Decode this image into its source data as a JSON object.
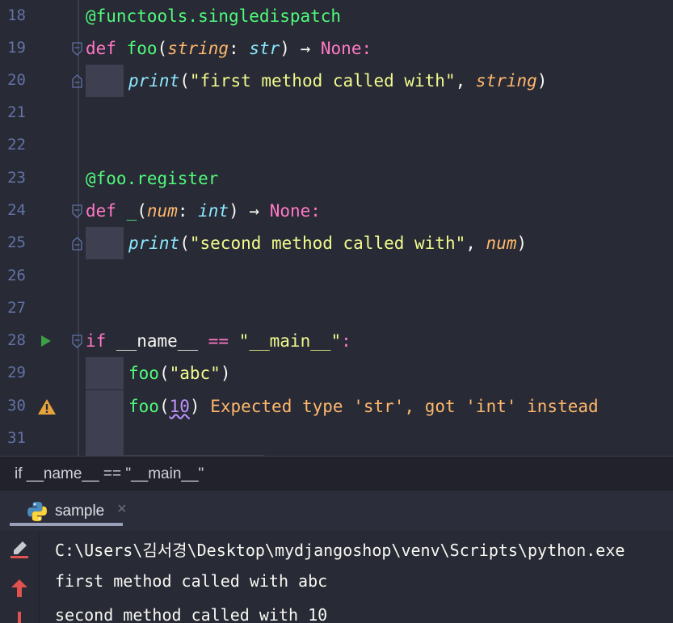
{
  "editor": {
    "lines": [
      {
        "num": "18"
      },
      {
        "num": "19"
      },
      {
        "num": "20"
      },
      {
        "num": "21"
      },
      {
        "num": "22"
      },
      {
        "num": "23"
      },
      {
        "num": "24"
      },
      {
        "num": "25"
      },
      {
        "num": "26"
      },
      {
        "num": "27"
      },
      {
        "num": "28"
      },
      {
        "num": "29"
      },
      {
        "num": "30"
      },
      {
        "num": "31"
      }
    ],
    "code": {
      "l18_decorator": "@functools.singledispatch",
      "l19_def": "def",
      "l19_name": "foo",
      "l19_param": "string",
      "l19_type": "str",
      "l19_arrow": "→",
      "l19_ret": "None",
      "l20_print": "print",
      "l20_str": "\"first method called with\"",
      "l20_arg": "string",
      "l23_decorator": "@foo.register",
      "l24_def": "def",
      "l24_name": "_",
      "l24_param": "num",
      "l24_type": "int",
      "l24_arrow": "→",
      "l24_ret": "None",
      "l25_print": "print",
      "l25_str": "\"second method called with\"",
      "l25_arg": "num",
      "l28_if": "if",
      "l28_name": "__name__",
      "l28_op": "==",
      "l28_str": "\"__main__\"",
      "l29_call": "foo",
      "l29_arg": "\"abc\"",
      "l30_call": "foo",
      "l30_arg": "10",
      "l30_warning": "Expected type 'str', got 'int' instead"
    },
    "gutter_icons": {
      "run": "run-triangle-icon",
      "warning": "warning-icon"
    }
  },
  "breadcrumb": {
    "text": "if __name__ == \"__main__\""
  },
  "run_panel": {
    "tab_label": "sample",
    "tab_close": "×",
    "console_lines": [
      "C:\\Users\\김서경\\Desktop\\mydjangoshop\\venv\\Scripts\\python.exe",
      "first method called with abc",
      "second method called with 10"
    ]
  },
  "colors": {
    "background": "#282a36",
    "keyword": "#ff79c6",
    "function": "#50fa7b",
    "string": "#f1fa8c",
    "param": "#ffb86c",
    "type": "#8be9fd",
    "warning": "#ffb86c"
  }
}
